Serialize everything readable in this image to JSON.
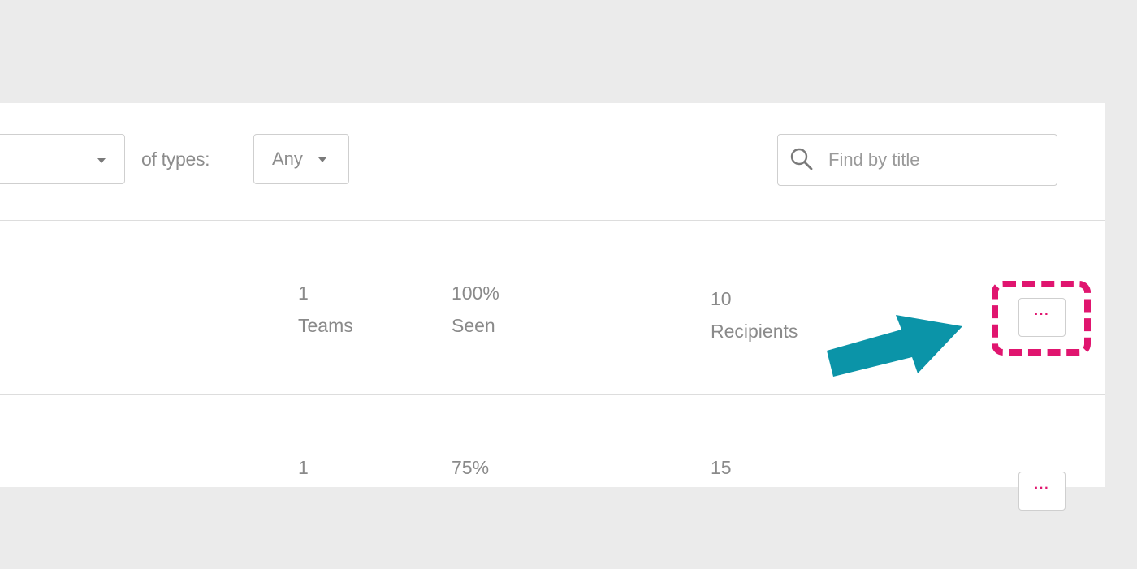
{
  "toolbar": {
    "types_label": "of types:",
    "any_value": "Any",
    "search_placeholder": "Find by title"
  },
  "rows": [
    {
      "recipients_count": "10",
      "recipients_label": "Recipients",
      "teams_count": "1",
      "teams_label": "Teams",
      "seen_percent": "100%",
      "seen_label": "Seen",
      "more_label": "···"
    },
    {
      "recipients_count": "15",
      "teams_count": "1",
      "seen_percent": "75%",
      "more_label": "···"
    }
  ],
  "annotation": {
    "highlight_color": "#e0156f",
    "arrow_color": "#0b94a8"
  },
  "icons": [
    "search-icon",
    "chevron-down-icon",
    "more-options-icon",
    "arrow-pointer"
  ]
}
